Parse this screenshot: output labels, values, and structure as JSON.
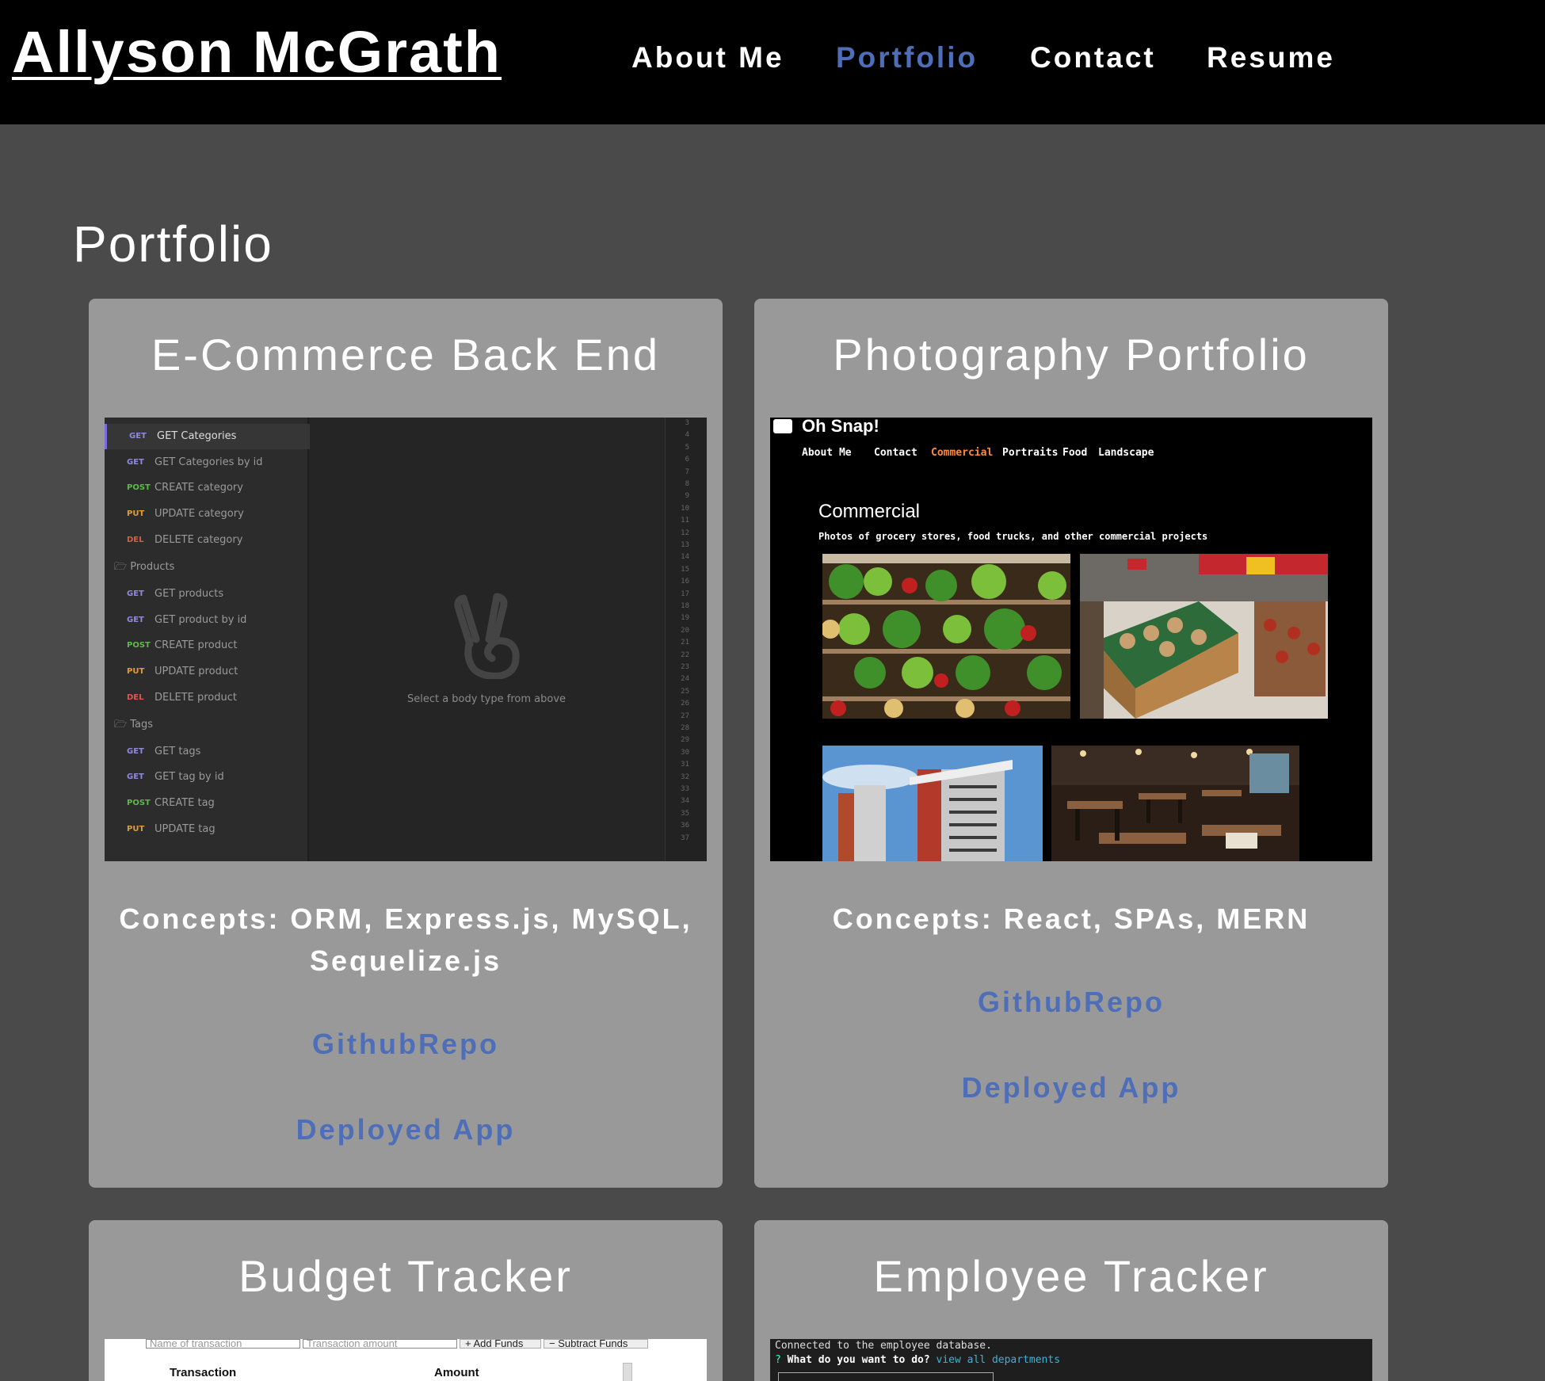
{
  "header": {
    "site_name": "Allyson McGrath",
    "nav": [
      {
        "label": "About Me",
        "active": false
      },
      {
        "label": "Portfolio",
        "active": true
      },
      {
        "label": "Contact",
        "active": false
      },
      {
        "label": "Resume",
        "active": false
      }
    ]
  },
  "page_title": "Portfolio",
  "projects": [
    {
      "title": "E-Commerce Back End",
      "concepts": "Concepts: ORM, Express.js, MySQL, Sequelize.js",
      "github": "GithubRepo",
      "deployed": "Deployed App",
      "screenshot": {
        "requests": [
          {
            "verb": "GET",
            "name": "GET Categories"
          },
          {
            "verb": "GET",
            "name": "GET Categories by id"
          },
          {
            "verb": "POST",
            "name": "CREATE category"
          },
          {
            "verb": "PUT",
            "name": "UPDATE category"
          },
          {
            "verb": "DEL",
            "name": "DELETE category"
          },
          {
            "folder": "Products"
          },
          {
            "verb": "GET",
            "name": "GET products"
          },
          {
            "verb": "GET",
            "name": "GET product by id"
          },
          {
            "verb": "POST",
            "name": "CREATE product"
          },
          {
            "verb": "PUT",
            "name": "UPDATE product"
          },
          {
            "verb": "DEL",
            "name": "DELETE product"
          },
          {
            "folder": "Tags"
          },
          {
            "verb": "GET",
            "name": "GET tags"
          },
          {
            "verb": "GET",
            "name": "GET tag by id"
          },
          {
            "verb": "POST",
            "name": "CREATE tag"
          },
          {
            "verb": "PUT",
            "name": "UPDATE tag"
          }
        ],
        "hint": "Select a body type from above",
        "line_numbers": [
          "3",
          "4",
          "5",
          "6",
          "7",
          "8",
          "9",
          "10",
          "11",
          "12",
          "13",
          "14",
          "15",
          "16",
          "17",
          "18",
          "19",
          "20",
          "21",
          "22",
          "23",
          "24",
          "25",
          "26",
          "27",
          "28",
          "29",
          "30",
          "31",
          "32",
          "33",
          "34",
          "35",
          "36",
          "37"
        ]
      }
    },
    {
      "title": "Photography Portfolio",
      "concepts": "Concepts: React, SPAs, MERN",
      "github": "GithubRepo",
      "deployed": "Deployed App",
      "screenshot": {
        "logo": "Oh Snap!",
        "nav": [
          {
            "label": "About Me",
            "active": false
          },
          {
            "label": "Contact",
            "active": false
          },
          {
            "label": "Commercial",
            "active": true
          },
          {
            "label": "Portraits",
            "active": false
          },
          {
            "label": "Food",
            "active": false
          },
          {
            "label": "Landscape",
            "active": false
          }
        ],
        "heading": "Commercial",
        "subheading": "Photos of grocery stores, food trucks, and other commercial projects"
      }
    },
    {
      "title": "Budget Tracker",
      "screenshot": {
        "name_placeholder": "Name of transaction",
        "amount_placeholder": "Transaction amount",
        "add_label": "+ Add Funds",
        "subtract_label": "− Subtract Funds",
        "col_transaction": "Transaction",
        "col_amount": "Amount"
      }
    },
    {
      "title": "Employee Tracker",
      "screenshot": {
        "line1": "Connected to the employee database.",
        "prompt_mark": "?",
        "question": "What do you want to do?",
        "answer": "view all departments"
      }
    }
  ],
  "colors": {
    "background": "#4a4a4a",
    "header": "#000000",
    "card": "#999999",
    "link": "#4e6fb8",
    "get": "#8d8ae0",
    "post": "#5fb84a",
    "put": "#e39a3b",
    "del": "#e0584a"
  }
}
